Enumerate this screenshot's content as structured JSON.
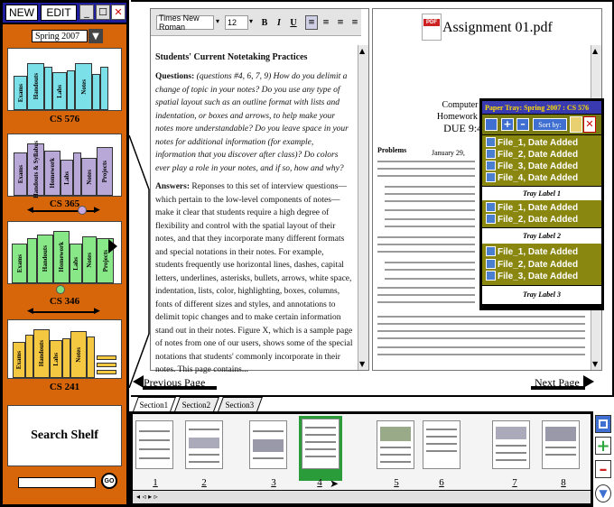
{
  "sidebar": {
    "new_label": "NEW",
    "edit_label": "EDIT",
    "semester": "Spring 2007",
    "shelves": [
      {
        "name": "CS 576",
        "books": [
          "Exams",
          "Handouts",
          "Labs",
          "Notes"
        ]
      },
      {
        "name": "CS 365",
        "books": [
          "Exams",
          "Handouts & Syllabus",
          "Homework",
          "Labs",
          "Notes",
          "Projects"
        ]
      },
      {
        "name": "CS 346",
        "books": [
          "Exams",
          "Handouts",
          "Homework",
          "Labs",
          "Notes",
          "Projects"
        ]
      },
      {
        "name": "CS 241",
        "books": [
          "Exams",
          "Handouts",
          "Labs",
          "Notes"
        ]
      }
    ],
    "search_label": "Search Shelf",
    "go_label": "GO"
  },
  "editor": {
    "font": "Times New Roman",
    "size": "12",
    "title": "Students' Current Notetaking Practices",
    "questions_label": "Questions:",
    "questions_text": "(questions #4, 6, 7, 9) How do you delimit a change of topic in your notes? Do you use any type of spatial layout such as an outline format with lists and indentation, or boxes and arrows, to help make your notes more understandable? Do you leave space in your notes for additional information (for example, information that you discover after class)? Do colors ever play a role in your notes, and if so, how and why?",
    "answers_label": "Answers:",
    "answers_text": "Reponses to this set of interview questions—which pertain to the low-level components of notes—make it clear that students require a high degree of flexibility and control with the spatial layout of their notes, and that they incorporate many different formats and special notations in their notes. For example, students frequently use horizontal lines, dashes, capital letters, underlines, asterisks, bullets, arrows, white space, indentation, lists, color, highlighting, boxes, columns, fonts of different sizes and styles, and annotations to delimit topic changes and to make certain information stand out in their notes. Figure X, which is a sample page of notes from one of our users, shows some of the special notations that students' commonly incorporate in their notes. This page contains..."
  },
  "pdf": {
    "title": "Assignment 01.pdf",
    "icon_text": "PDF",
    "course": "Computer Science 365",
    "assignment": "Homework Assignment 1",
    "due": "DUE 9:40am, Feb",
    "date_fragment": "January 29,",
    "problems_label": "Problems"
  },
  "tray": {
    "header": "Paper Tray: Spring 2007 : CS 576",
    "sort_label": "Sort by:",
    "groups": [
      {
        "label": "Tray Label 1",
        "files": [
          "File_1, Date Added",
          "File_2, Date Added",
          "File_3, Date Added",
          "File_4, Date Added"
        ]
      },
      {
        "label": "Tray Label 2",
        "files": [
          "File_1, Date Added",
          "File_2, Date Added"
        ]
      },
      {
        "label": "Tray Label 3",
        "files": [
          "File_1, Date Added",
          "File_2, Date Added",
          "File_3, Date Added"
        ]
      }
    ]
  },
  "pager": {
    "prev": "Previous Page",
    "next": "Next Page"
  },
  "sections": [
    "Section1",
    "Section2",
    "Section3"
  ],
  "thumbnails": [
    "1",
    "2",
    "3",
    "4",
    "5",
    "6",
    "7",
    "8"
  ],
  "scroll_controls": "◂ ◃ ▸ ▹"
}
